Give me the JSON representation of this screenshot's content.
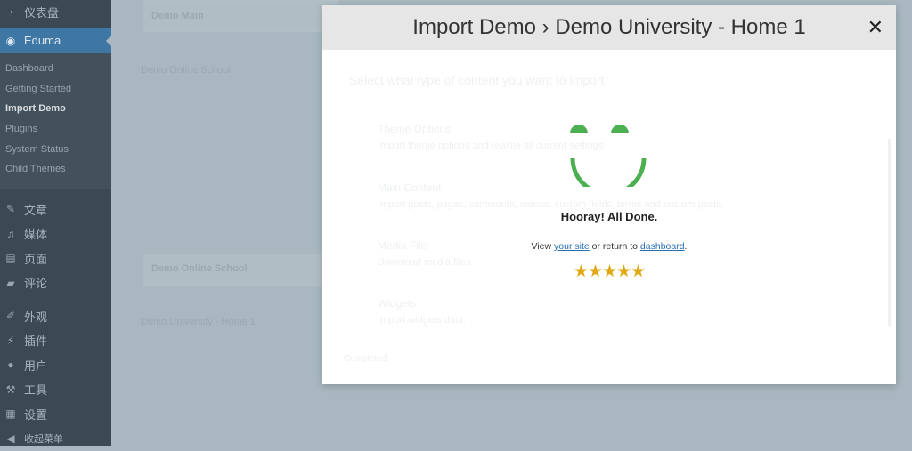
{
  "sidebar": {
    "top": [
      {
        "icon": "dashboard-icon",
        "label": "仪表盘"
      }
    ],
    "active": {
      "icon": "eduma-icon",
      "label": "Eduma"
    },
    "submenu": [
      "Dashboard",
      "Getting Started",
      "Import Demo",
      "Plugins",
      "System Status",
      "Child Themes"
    ],
    "current_sub": "Import Demo",
    "group1": [
      {
        "icon": "pin-icon",
        "label": "文章"
      },
      {
        "icon": "media-icon",
        "label": "媒体"
      },
      {
        "icon": "page-icon",
        "label": "页面"
      },
      {
        "icon": "comment-icon",
        "label": "评论"
      }
    ],
    "group2": [
      {
        "icon": "appearance-icon",
        "label": "外观"
      },
      {
        "icon": "plugin-icon",
        "label": "插件"
      },
      {
        "icon": "user-icon",
        "label": "用户"
      },
      {
        "icon": "wrench-icon",
        "label": "工具"
      },
      {
        "icon": "settings-icon",
        "label": "设置"
      }
    ],
    "collapse": {
      "icon": "collapse-icon",
      "label": "收起菜单"
    }
  },
  "background": {
    "card1": "Demo Main",
    "img1": "Demo Online School",
    "card2": "Demo Online School",
    "img2": "Demo University - Home 1"
  },
  "modal": {
    "title": "Import Demo › Demo University - Home 1",
    "close": "✕",
    "faded_heading": "Select what type of content you want to import",
    "options": [
      {
        "title": "Theme Options",
        "desc": "Import theme options and rewrite all current settings."
      },
      {
        "title": "Main Content",
        "desc": "Import posts, pages, comments, menus, custom fields, terms and custom posts."
      },
      {
        "title": "Media File",
        "desc": "Download media files."
      },
      {
        "title": "Widgets",
        "desc": "Import widgets data."
      }
    ],
    "footer_button": "Completed",
    "done_title": "Hooray! All Done.",
    "msg_prefix": "View ",
    "link_site": "your site",
    "msg_mid": " or return to ",
    "link_dashboard": "dashboard",
    "msg_suffix": ".",
    "rating": 5,
    "stars": "★★★★★",
    "colors": {
      "smile": "#4caf50",
      "stars": "#e2a60f",
      "link": "#2a6fb0"
    }
  }
}
